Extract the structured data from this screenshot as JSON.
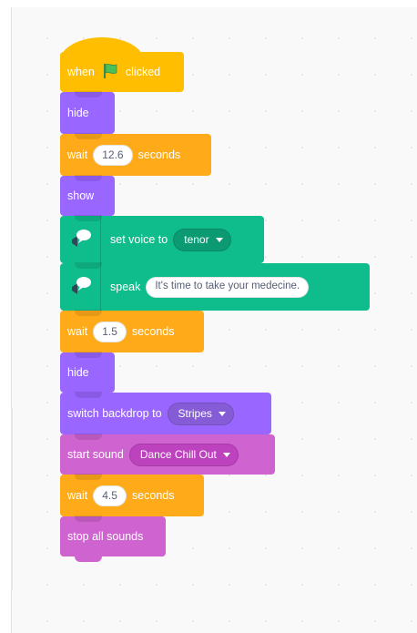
{
  "colors": {
    "events": "#ffbf00",
    "looks": "#9966ff",
    "control": "#ffab19",
    "extension": "#0fbd8c",
    "sound": "#cf63cf",
    "flag": "#4cbf56"
  },
  "script": {
    "when_flag": {
      "before": "when",
      "icon": "green-flag-icon",
      "after": "clicked"
    },
    "hide_1": {
      "label": "hide"
    },
    "wait_1": {
      "label": "wait",
      "value": "12.6",
      "unit": "seconds"
    },
    "show": {
      "label": "show"
    },
    "set_voice": {
      "icon": "speech-bubble-icon",
      "label": "set voice to",
      "value": "tenor"
    },
    "speak": {
      "icon": "speech-bubble-icon",
      "label": "speak",
      "value": "It's time to take your medecine."
    },
    "wait_2": {
      "label": "wait",
      "value": "1.5",
      "unit": "seconds"
    },
    "hide_2": {
      "label": "hide"
    },
    "switch_backdrop": {
      "label": "switch backdrop to",
      "value": "Stripes"
    },
    "start_sound": {
      "label": "start sound",
      "value": "Dance Chill Out"
    },
    "wait_3": {
      "label": "wait",
      "value": "4.5",
      "unit": "seconds"
    },
    "stop_sounds": {
      "label": "stop all sounds"
    }
  }
}
